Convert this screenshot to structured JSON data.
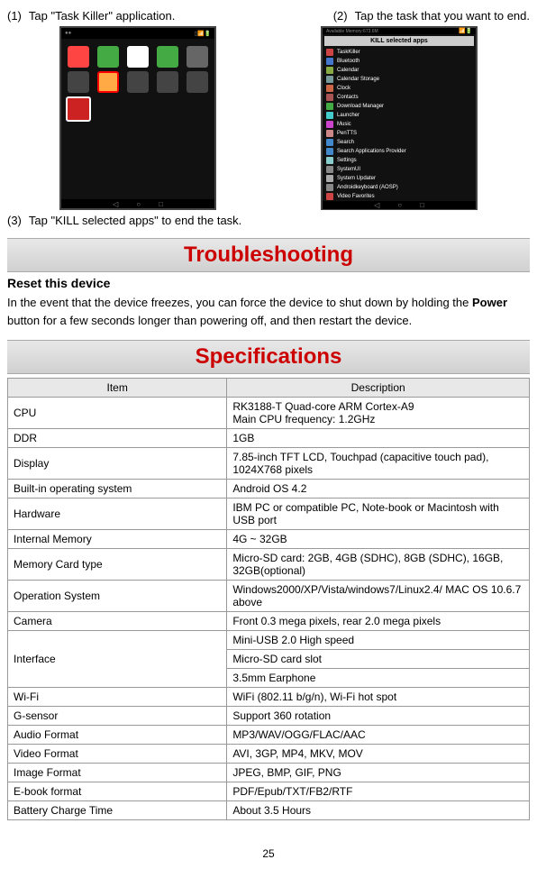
{
  "steps": {
    "s1_num": "(1)",
    "s1_text": "Tap \"Task Killer\" application.",
    "s2_num": "(2)",
    "s2_text": "Tap the task that you want to end.",
    "s3_num": "(3)",
    "s3_text": "Tap \"KILL selected apps\" to end the task."
  },
  "screenshot2": {
    "header": "KILL selected apps",
    "items": [
      "TaskKiller",
      "Bluetooth",
      "Calendar",
      "Calendar Storage",
      "Clock",
      "Contacts",
      "Download Manager",
      "Launcher",
      "Music",
      "PenTTS",
      "Search",
      "Search Applications Provider",
      "Settings",
      "SystemUI",
      "System Updater",
      "Androidkeyboard (AOSP)",
      "Video Favorites"
    ]
  },
  "troubleshooting": {
    "header": "Troubleshooting",
    "subheading": "Reset this device",
    "body_p1": "In the event that the device freezes, you can force the device to shut down by holding the ",
    "body_bold": "Power",
    "body_p2": " button for a few seconds longer than powering off, and then restart the device."
  },
  "specifications": {
    "header": "Specifications",
    "th_item": "Item",
    "th_desc": "Description",
    "rows": {
      "cpu_label": "CPU",
      "cpu_line1": "RK3188-T Quad-core ARM Cortex-A9",
      "cpu_line2": "Main CPU frequency: 1.2GHz",
      "ddr_label": "DDR",
      "ddr_val": "1GB",
      "display_label": "Display",
      "display_val": "7.85-inch TFT LCD, Touchpad (capacitive touch pad), 1024X768 pixels",
      "os_label": "Built-in operating system",
      "os_val": "Android OS 4.2",
      "hw_label": "Hardware",
      "hw_val": "IBM PC or compatible PC, Note-book or Macintosh with USB port",
      "mem_label": "Internal Memory",
      "mem_val": "4G ~ 32GB",
      "card_label": "Memory Card type",
      "card_line1": "Micro-SD card: 2GB, 4GB (SDHC), 8GB (SDHC), 16GB,",
      "card_line2": "32GB(optional)",
      "opsys_label": "Operation System",
      "opsys_val": "Windows2000/XP/Vista/windows7/Linux2.4/ MAC OS 10.6.7 above",
      "cam_label": "Camera",
      "cam_val": "Front 0.3 mega pixels, rear 2.0 mega pixels",
      "iface_label": "Interface",
      "iface_1": "Mini-USB 2.0 High speed",
      "iface_2": "Micro-SD card slot",
      "iface_3": "3.5mm Earphone",
      "wifi_label": "Wi-Fi",
      "wifi_val": "WiFi (802.11 b/g/n), Wi-Fi hot spot",
      "g_label": "G-sensor",
      "g_val": "Support 360 rotation",
      "audio_label": "Audio Format",
      "audio_val": "MP3/WAV/OGG/FLAC/AAC",
      "video_label": "Video Format",
      "video_val": "AVI, 3GP, MP4, MKV, MOV",
      "image_label": "Image Format",
      "image_val": "JPEG, BMP, GIF, PNG",
      "ebook_label": "E-book format",
      "ebook_val": "PDF/Epub/TXT/FB2/RTF",
      "batt_label": "Battery Charge Time",
      "batt_val": "About 3.5 Hours"
    }
  },
  "page_number": "25"
}
